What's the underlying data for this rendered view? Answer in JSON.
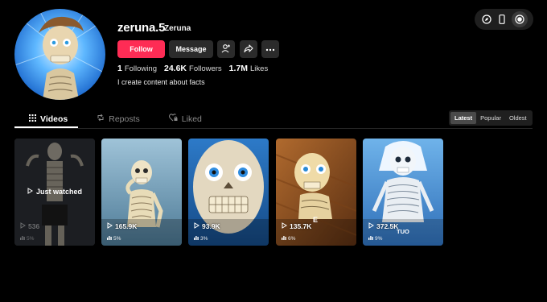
{
  "header": {
    "username": "zeruna.5",
    "nickname": "Zeruna",
    "follow_label": "Follow",
    "message_label": "Message",
    "following_count": "1",
    "following_label": "Following",
    "followers_count": "24.6K",
    "followers_label": "Followers",
    "likes_count": "1.7M",
    "likes_label": "Likes",
    "bio": "I create content about facts"
  },
  "tabs": [
    {
      "label": "Videos",
      "icon": "grid-icon",
      "active": true
    },
    {
      "label": "Reposts",
      "icon": "repost-icon",
      "active": false
    },
    {
      "label": "Liked",
      "icon": "heart-lock-icon",
      "active": false
    }
  ],
  "sort": {
    "options": [
      "Latest",
      "Popular",
      "Oldest"
    ],
    "selected": "Latest"
  },
  "videos": [
    {
      "views": "536",
      "percent": "5%",
      "watched_label": "Just watched"
    },
    {
      "views": "165.9K",
      "percent": "5%"
    },
    {
      "views": "93.9K",
      "percent": "3%"
    },
    {
      "views": "135.7K",
      "percent": "6%",
      "caption": "E"
    },
    {
      "views": "372.5K",
      "percent": "9%",
      "caption": "TUO"
    }
  ],
  "colors": {
    "accent": "#fe2c55",
    "background": "#000000",
    "button": "#2b2b2b"
  }
}
